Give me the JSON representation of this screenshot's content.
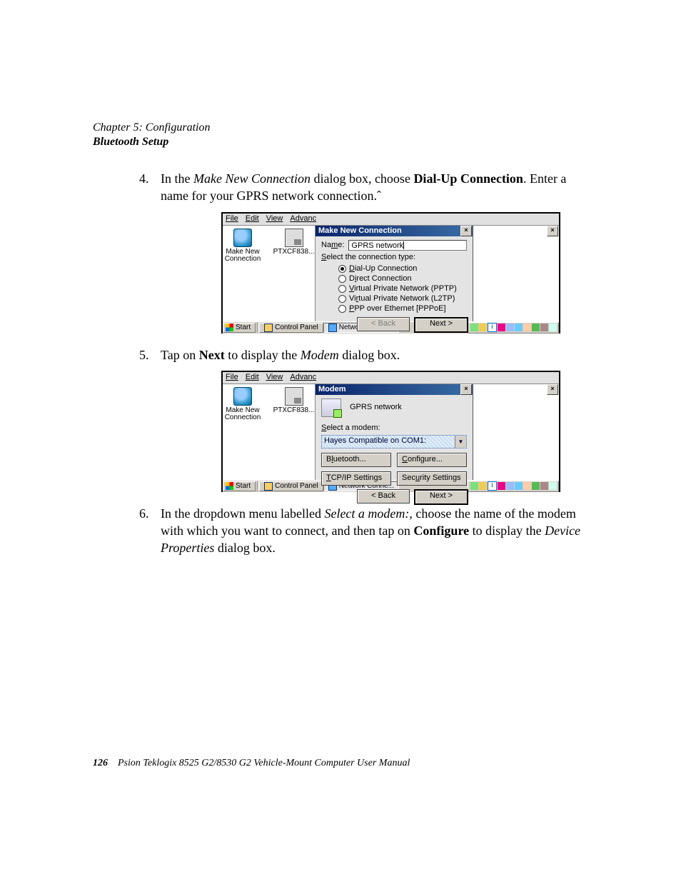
{
  "header": {
    "chapter": "Chapter 5: Configuration",
    "section": "Bluetooth Setup"
  },
  "steps": {
    "s4": {
      "pre": "In the ",
      "dialogName": "Make New Connection",
      "mid": " dialog box, choose ",
      "choice": "Dial-Up Connection",
      "post1": ". Enter a name for your GPRS network connection.ˆ"
    },
    "s5": {
      "pre": "Tap on ",
      "btn": "Next",
      "mid": " to display the ",
      "dlg": "Modem",
      "post": " dialog box."
    },
    "s6": {
      "pre": "In the dropdown menu labelled ",
      "lbl": "Select a modem:",
      "mid": ", choose the name of the modem with which you want to connect, and then tap on ",
      "btn": "Configure",
      "mid2": " to display the ",
      "dlg": "Device Properties",
      "post": " dialog box."
    }
  },
  "shared": {
    "menubar": {
      "file": "File",
      "edit": "Edit",
      "view": "View",
      "advanced": "Advanc"
    },
    "leftIcons": {
      "makeNew1": "Make New",
      "makeNew2": "Connection",
      "pt": "PTXCF838..."
    },
    "taskbar": {
      "start": "Start",
      "controlPanel": "Control Panel",
      "networkConne": "Network Conne..."
    },
    "buttons": {
      "back": "< Back",
      "next": "Next >",
      "close": "×"
    }
  },
  "ss1": {
    "title": "Make New Connection",
    "nameLabel": "Name:",
    "nameValue": "GPRS network",
    "selectType": "Select the connection type:",
    "radios": {
      "dialup": "Dial-Up Connection",
      "direct": "Direct Connection",
      "pptp": "Virtual Private Network (PPTP)",
      "l2tp": "Virtual Private Network (L2TP)",
      "pppoe": "PPP over Ethernet [PPPoE]"
    }
  },
  "ss2": {
    "title": "Modem",
    "connName": "GPRS network",
    "selectModem": "Select a modem:",
    "modemValue": "Hayes Compatible on COM1:",
    "buttons": {
      "bluetooth": "Bluetooth...",
      "configure": "Configure...",
      "tcpip": "TCP/IP Settings",
      "security": "Security Settings"
    }
  },
  "footer": {
    "pageNum": "126",
    "manual": "Psion Teklogix 8525 G2/8530 G2 Vehicle-Mount Computer User Manual"
  }
}
